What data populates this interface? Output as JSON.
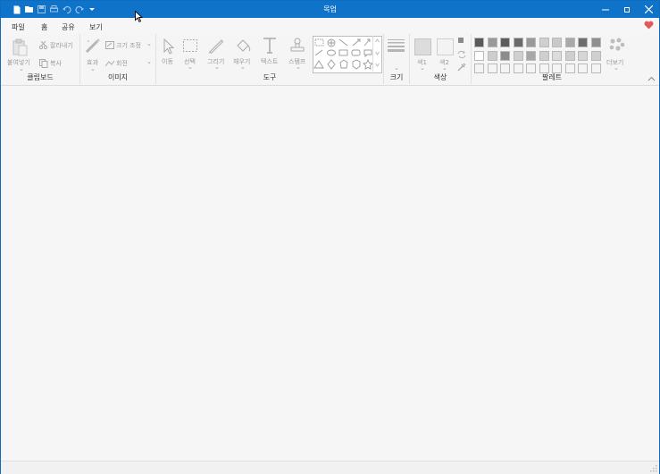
{
  "window": {
    "title": "목업"
  },
  "menu": {
    "tabs": [
      "파일",
      "홈",
      "공유",
      "보기"
    ],
    "active": 1
  },
  "ribbon": {
    "clipboard": {
      "paste": "붙여넣기",
      "cut": "잘라내기",
      "copy": "복사",
      "group": "클립보드"
    },
    "image": {
      "effect": "효과",
      "resize": "크기 조정",
      "rotate": "회전",
      "group": "이미지"
    },
    "tools": {
      "move": "이동",
      "select": "선택",
      "draw": "그리기",
      "fill": "채우기",
      "text": "텍스트",
      "stamp": "스탬프",
      "group": "도구"
    },
    "size": {
      "group": "크기"
    },
    "colors": {
      "color1": "색1",
      "color2": "색2",
      "group": "색상"
    },
    "palette": {
      "more": "더보기",
      "group": "팔레트"
    }
  },
  "palette_colors": [
    [
      "#5a5a5a",
      "#9a9a9a",
      "#5c5c5c",
      "#6a6a6a",
      "#999999",
      "#cfcfcf",
      "#c9c9c9",
      "#a9a9a9",
      "#6e6e6e",
      "#8f8f8f"
    ],
    [
      "#ffffff",
      "#cdcdcd",
      "#8c8c8c",
      "#cfcfcf",
      "#a7a7a7",
      "#cfcfcf",
      "#dcdcdc",
      "#cfcfcf",
      "#d6d6d6",
      "#cfcfcf"
    ],
    [
      "#f4f4f4",
      "#f4f4f4",
      "#f4f4f4",
      "#f4f4f4",
      "#f4f4f4",
      "#f4f4f4",
      "#f4f4f4",
      "#f4f4f4",
      "#f4f4f4",
      "#f4f4f4"
    ]
  ],
  "colors": {
    "titlebar": "#0e73c9",
    "accent": "#2b6fb6",
    "heart": "#e05a5a"
  }
}
